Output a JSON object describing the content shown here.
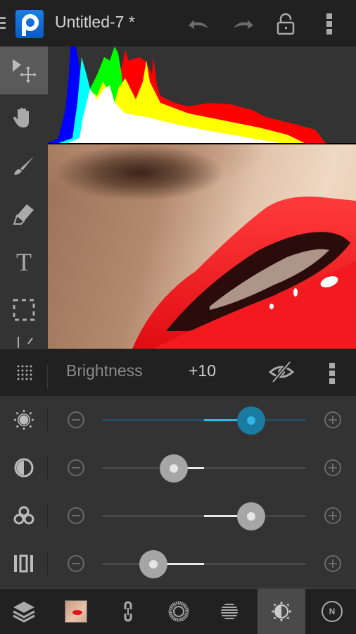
{
  "app": {
    "title": "Untitled-7 *",
    "logo_letter": "P",
    "actions": [
      {
        "name": "undo",
        "icon": "undo-icon"
      },
      {
        "name": "redo",
        "icon": "redo-icon"
      },
      {
        "name": "lock",
        "icon": "unlock-icon"
      },
      {
        "name": "overflow",
        "icon": "overflow-menu-icon"
      }
    ]
  },
  "tools": [
    {
      "name": "move",
      "icon": "move-tool-icon",
      "active": true
    },
    {
      "name": "hand",
      "icon": "hand-icon",
      "active": false
    },
    {
      "name": "brush",
      "icon": "brush-icon",
      "active": false
    },
    {
      "name": "eraser",
      "icon": "eraser-icon",
      "active": false
    },
    {
      "name": "text",
      "icon": "text-icon",
      "label": "T",
      "active": false
    },
    {
      "name": "selection",
      "icon": "marquee-select-icon",
      "active": false
    },
    {
      "name": "crop",
      "icon": "crop-icon",
      "active": false
    }
  ],
  "histogram": {
    "channels": [
      "blue",
      "cyan",
      "green",
      "white",
      "yellow",
      "red"
    ],
    "colors": {
      "blue": "#0000ff",
      "cyan": "#00ffff",
      "green": "#00ff00",
      "white": "#ffffff",
      "yellow": "#ffff00",
      "red": "#ff0000"
    }
  },
  "adjustment": {
    "name": "Brightness",
    "value": "+10",
    "visibility": "hidden-eye-icon"
  },
  "sliders": [
    {
      "name": "brightness",
      "icon": "brightness-icon",
      "value": 0.73,
      "active": true
    },
    {
      "name": "contrast",
      "icon": "contrast-icon",
      "value": 0.35,
      "active": false
    },
    {
      "name": "saturation",
      "icon": "saturation-icon",
      "value": 0.73,
      "active": false
    },
    {
      "name": "levels",
      "icon": "levels-icon",
      "value": 0.25,
      "active": false
    }
  ],
  "bottom_bar": [
    {
      "name": "layers",
      "icon": "layers-icon"
    },
    {
      "name": "layer-thumbnail",
      "icon": "layer-thumbnail"
    },
    {
      "name": "link",
      "icon": "link-icon"
    },
    {
      "name": "mask",
      "icon": "mask-icon"
    },
    {
      "name": "filter",
      "icon": "filter-icon"
    },
    {
      "name": "adjustments",
      "icon": "brightness-contrast-icon",
      "active": true
    },
    {
      "name": "blend-mode",
      "icon": "blend-mode-icon",
      "label": "N"
    }
  ],
  "colors": {
    "accent": "#33b5e5",
    "background": "#212121",
    "panel": "#333333"
  }
}
